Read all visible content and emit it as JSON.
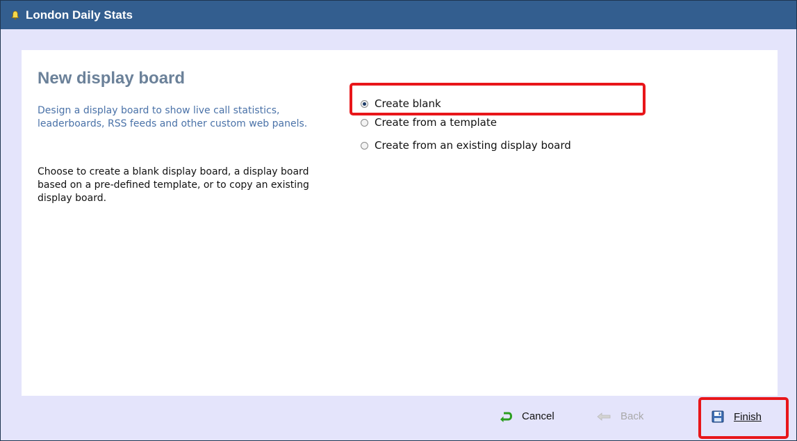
{
  "window": {
    "title": "London Daily Stats",
    "icon": "bell-icon"
  },
  "main": {
    "heading": "New display board",
    "intro": "Design a display board to show live call statistics, leaderboards, RSS feeds and other custom web panels.",
    "instructions": "Choose to create a blank display board, a display board based on a pre-defined template, or to copy an existing display board."
  },
  "options": [
    {
      "label": "Create blank",
      "checked": true
    },
    {
      "label": "Create from a template",
      "checked": false
    },
    {
      "label": "Create from an existing display board",
      "checked": false
    }
  ],
  "footer": {
    "cancel_label": "Cancel",
    "back_label": "Back",
    "finish_label": "Finish",
    "cancel_icon": "undo-arrow-icon",
    "back_icon": "left-arrow-icon",
    "finish_icon": "save-disk-icon"
  },
  "colors": {
    "titlebar": "#335e8f",
    "background": "#e4e4fb",
    "heading": "#6b8199",
    "intro_text": "#4a72a8",
    "highlight": "#e8161a"
  }
}
